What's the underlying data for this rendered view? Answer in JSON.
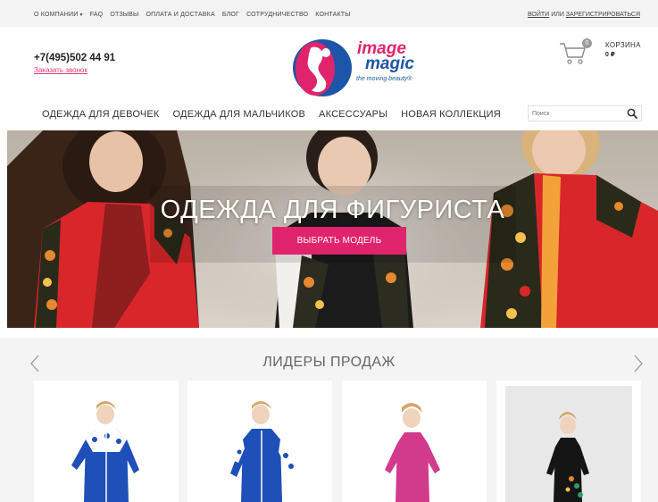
{
  "topnav": {
    "items": [
      "О КОМПАНИИ",
      "FAQ",
      "ОТЗЫВЫ",
      "ОПЛАТА И ДОСТАВКА",
      "БЛОГ",
      "СОТРУДНИЧЕСТВО",
      "КОНТАКТЫ"
    ],
    "login": "ВОЙТИ",
    "or": "ИЛИ",
    "register": "ЗАРЕГИСТРИРОВАТЬСЯ"
  },
  "header": {
    "phone": "+7(495)502 44 91",
    "callback": "Заказать звонок",
    "logo": {
      "line1": "image",
      "line2": "magic",
      "tagline": "the moving beauty®"
    },
    "cart": {
      "label": "КОРЗИНА",
      "sum": "0 ₽",
      "count": "0"
    }
  },
  "mainnav": {
    "items": [
      "ОДЕЖДА ДЛЯ ДЕВОЧЕК",
      "ОДЕЖДА ДЛЯ МАЛЬЧИКОВ",
      "АКСЕССУАРЫ",
      "НОВАЯ КОЛЛЕКЦИЯ"
    ],
    "search_placeholder": "Поиск"
  },
  "hero": {
    "title": "ОДЕЖДА ДЛЯ ФИГУРИСТА",
    "button": "ВЫБРАТЬ МОДЕЛЬ"
  },
  "bestsellers": {
    "title": "ЛИДЕРЫ ПРОДАЖ"
  },
  "colors": {
    "accent": "#e0246b",
    "brand_blue": "#1d56a8",
    "hero_red": "#d8262a",
    "product_blue": "#1f4fb8",
    "product_pink": "#d23a8c",
    "product_black": "#151515"
  }
}
